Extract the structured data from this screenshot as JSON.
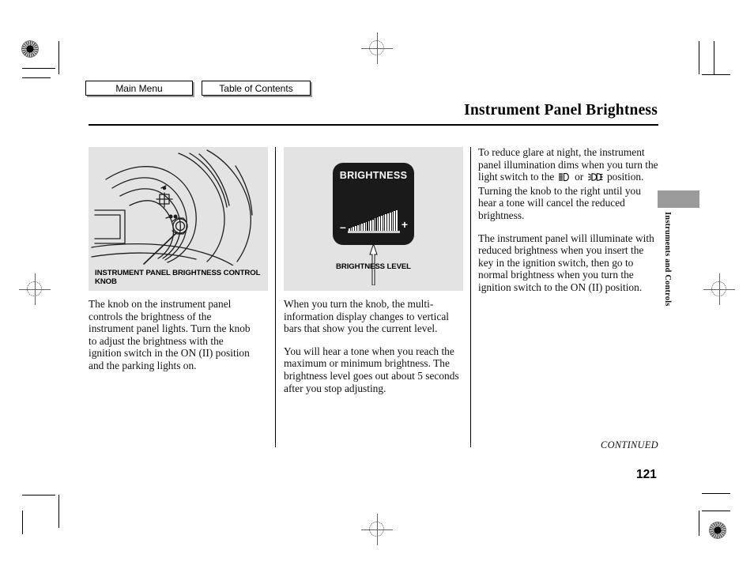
{
  "nav": {
    "main_menu": "Main Menu",
    "table_of_contents": "Table of Contents"
  },
  "header": {
    "title": "Instrument Panel Brightness"
  },
  "figures": {
    "knob": {
      "caption": "INSTRUMENT PANEL BRIGHTNESS CONTROL KNOB",
      "alt": "dashboard-line-art-with-brightness-knob"
    },
    "display": {
      "screen_title": "BRIGHTNESS",
      "minus": "–",
      "plus": "+",
      "caption": "BRIGHTNESS LEVEL",
      "bar_count": 23
    }
  },
  "columns": {
    "left": [
      "The knob on the instrument panel controls the brightness of the instrument panel lights. Turn the knob to adjust the brightness with the ignition switch in the ON (II) position and the parking lights on."
    ],
    "middle": [
      "When you turn the knob, the multi-information display changes to vertical bars that show you the current level.",
      "You will hear a tone when you reach the maximum or minimum brightness. The brightness level goes out about 5 seconds after you stop adjusting."
    ],
    "right": {
      "para1_before": "To reduce glare at night, the instrument panel illumination dims when you turn the light switch to the",
      "icon1_name": "parking-light-icon",
      "between_icons": "or",
      "icon2_name": "headlight-icon",
      "para1_after": "position. Turning the knob to the right until you hear a tone will cancel the reduced brightness.",
      "para2": "The instrument panel will illuminate with reduced brightness when you insert the key in the ignition switch, then go to normal brightness when you turn the ignition switch to the ON (II) position."
    }
  },
  "side_tab": {
    "label": "Instruments and Controls"
  },
  "footer": {
    "continued": "CONTINUED",
    "page_number": "121"
  }
}
